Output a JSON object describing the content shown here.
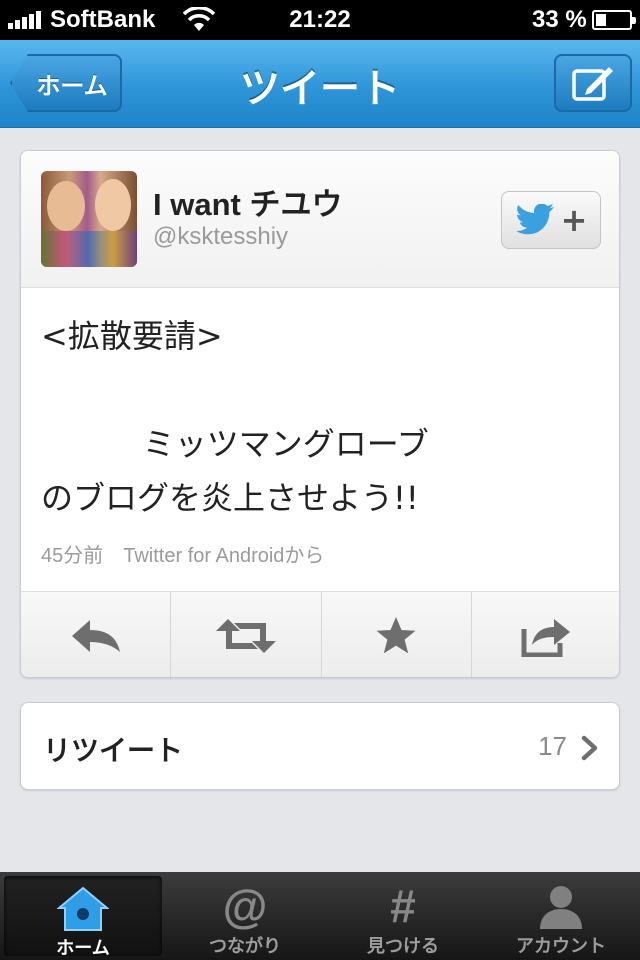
{
  "status_bar": {
    "carrier": "SoftBank",
    "time": "21:22",
    "battery": "33 %"
  },
  "nav": {
    "back_label": "ホーム",
    "title": "ツイート",
    "compose_icon": "compose-icon"
  },
  "tweet": {
    "user_name": "I want チユウ",
    "user_handle": "@ksktesshiy",
    "text": "<拡散要請>\n\n          ミッツマングローブ\nのブログを炎上させよう!!",
    "meta": "45分前　Twitter for Androidから",
    "follow_icon": "twitter-bird-plus-icon"
  },
  "actions": [
    {
      "name": "reply",
      "icon": "reply-icon"
    },
    {
      "name": "retweet",
      "icon": "retweet-icon"
    },
    {
      "name": "favorite",
      "icon": "star-icon"
    },
    {
      "name": "share",
      "icon": "share-icon"
    }
  ],
  "retweets": {
    "label": "リツイート",
    "count": "17"
  },
  "tab_bar": {
    "tabs": [
      {
        "label": "ホーム",
        "icon": "home-icon",
        "active": true
      },
      {
        "label": "つながり",
        "icon": "at-icon",
        "glyph": "@"
      },
      {
        "label": "見つける",
        "icon": "hash-icon",
        "glyph": "#"
      },
      {
        "label": "アカウント",
        "icon": "person-icon"
      }
    ]
  },
  "colors": {
    "nav_blue": "#2e95d8",
    "twitter_blue": "#3aa0e0",
    "tab_bar": "#1e1e1e"
  }
}
